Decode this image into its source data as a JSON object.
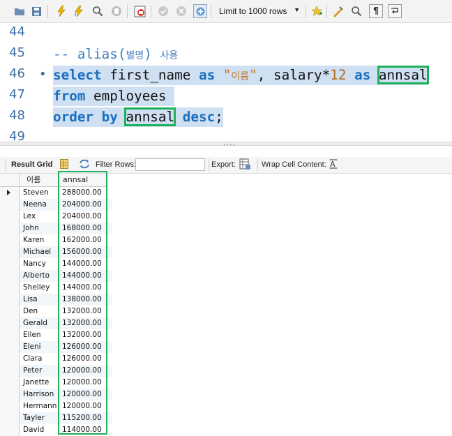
{
  "toolbar": {
    "icons": [
      "folder-icon",
      "save-icon",
      "lightning-icon",
      "lightning-cursor-icon",
      "magnifier-icon",
      "stop-icon",
      "stop-on-error-icon",
      "commit-icon",
      "rollback-icon",
      "autocommit-icon",
      "beautify-icon",
      "find-icon",
      "invisible-chars-icon",
      "wrap-icon",
      "favorite-icon"
    ],
    "limit_label": "Limit to 1000 rows"
  },
  "editor": {
    "lines": [
      {
        "num": "44"
      },
      {
        "num": "45",
        "comment": "-- alias(",
        "comment_kr": "별명",
        "comment_close": ")",
        "comment_tail": "사용"
      },
      {
        "num": "46",
        "kw_select": "select",
        "t1": " first_name ",
        "kw_as1": "as",
        "str_open": "\"",
        "str_kr": "이름",
        "str_close": "\"",
        "t2": ", salary*",
        "num12": "12",
        "t3": " ",
        "kw_as2": "as",
        "t4": " ",
        "alias": "annsal"
      },
      {
        "num": "47",
        "kw_from": "from",
        "t1": " employees "
      },
      {
        "num": "48",
        "kw_order": "order by",
        "t1": " ",
        "alias": "annsal",
        "t2": " ",
        "kw_desc": "desc",
        "semi": ";"
      },
      {
        "num": "49"
      }
    ]
  },
  "result_toolbar": {
    "result_grid": "Result Grid",
    "filter_rows": "Filter Rows:",
    "export": "Export:",
    "wrap": "Wrap Cell Content:"
  },
  "grid": {
    "headers": [
      "이름",
      "annsal"
    ],
    "rows": [
      [
        "Steven",
        "288000.00"
      ],
      [
        "Neena",
        "204000.00"
      ],
      [
        "Lex",
        "204000.00"
      ],
      [
        "John",
        "168000.00"
      ],
      [
        "Karen",
        "162000.00"
      ],
      [
        "Michael",
        "156000.00"
      ],
      [
        "Nancy",
        "144000.00"
      ],
      [
        "Alberto",
        "144000.00"
      ],
      [
        "Shelley",
        "144000.00"
      ],
      [
        "Lisa",
        "138000.00"
      ],
      [
        "Den",
        "132000.00"
      ],
      [
        "Gerald",
        "132000.00"
      ],
      [
        "Ellen",
        "132000.00"
      ],
      [
        "Eleni",
        "126000.00"
      ],
      [
        "Clara",
        "126000.00"
      ],
      [
        "Peter",
        "120000.00"
      ],
      [
        "Janette",
        "120000.00"
      ],
      [
        "Harrison",
        "120000.00"
      ],
      [
        "Hermann",
        "120000.00"
      ],
      [
        "Tayler",
        "115200.00"
      ],
      [
        "David",
        "114000.00"
      ]
    ]
  },
  "colors": {
    "keyword": "#1c6fc0",
    "selection": "#cfe0f2",
    "highlight": "#1fb05b",
    "line_number": "#3d6ea3"
  }
}
